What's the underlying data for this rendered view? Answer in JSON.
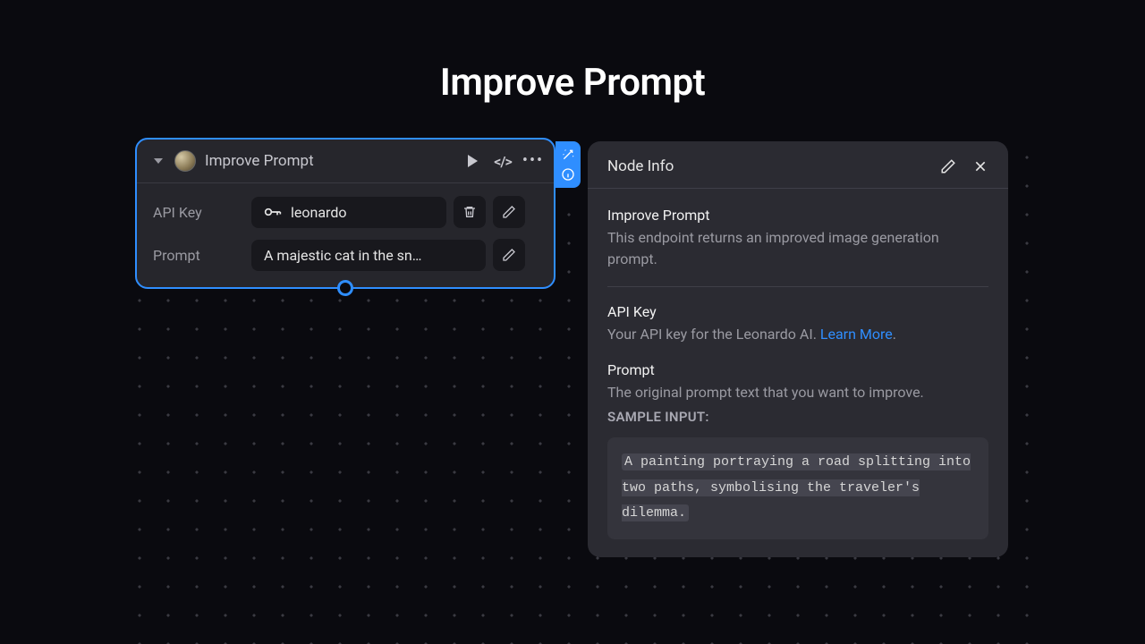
{
  "page": {
    "title": "Improve Prompt"
  },
  "node": {
    "title": "Improve Prompt",
    "fields": {
      "apiKey": {
        "label": "API Key",
        "value": "leonardo"
      },
      "prompt": {
        "label": "Prompt",
        "value": "A majestic cat in the sn…"
      }
    }
  },
  "info": {
    "panelTitle": "Node Info",
    "sections": {
      "main": {
        "title": "Improve Prompt",
        "desc": "This endpoint returns an improved image generation prompt."
      },
      "apiKey": {
        "title": "API Key",
        "desc": "Your API key for the Leonardo AI. ",
        "link": "Learn More",
        "after": "."
      },
      "prompt": {
        "title": "Prompt",
        "desc": "The original prompt text that you want to improve.",
        "sampleLabel": "SAMPLE INPUT:",
        "sample": "A painting portraying a road splitting into two paths, symbolising the traveler's dilemma."
      }
    }
  }
}
